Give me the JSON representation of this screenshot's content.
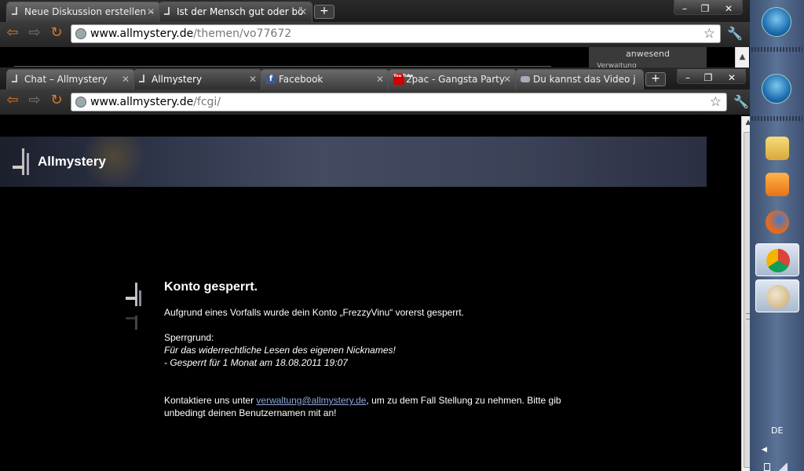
{
  "back_window": {
    "tabs": [
      {
        "label": "Neue Diskussion erstellen –"
      },
      {
        "label": "Ist der Mensch gut oder bö"
      }
    ],
    "url_domain": "www.allmystery.de",
    "url_path": "/themen/vo77672",
    "peek_label": "anwesend",
    "peek_label2": "Verwaltung"
  },
  "front_window": {
    "tabs": [
      {
        "label": "Chat – Allmystery"
      },
      {
        "label": "Allmystery"
      },
      {
        "label": "Facebook"
      },
      {
        "label": "2pac - Gangsta Party"
      },
      {
        "label": "Du kannst das Video j"
      }
    ],
    "url_domain": "www.allmystery.de",
    "url_path": "/fcgi/",
    "youtube_favicon_text": "You Tube",
    "facebook_favicon_text": "f"
  },
  "window_controls": {
    "minimize": "–",
    "maximize": "❐",
    "close": "✕"
  },
  "page": {
    "logo_text": "Allmystery",
    "heading": "Konto gesperrt.",
    "message": "Aufgrund eines Vorfalls wurde dein Konto „FrezzyVinu“ vorerst gesperrt.",
    "reason_label": "Sperrgrund:",
    "reason_line1": "Für das widerrechtliche Lesen des eigenen Nicknames!",
    "reason_line2": "- Gesperrt für 1 Monat am 18.08.2011 19:07",
    "contact_pre": "Kontaktiere uns unter ",
    "contact_email": "verwaltung@allmystery.de",
    "contact_post": ", um zu dem Fall Stellung zu nehmen. Bitte gib unbedingt deinen Benutzernamen mit an!"
  },
  "taskbar": {
    "language": "DE"
  },
  "colors": {
    "link": "#8fa8d8",
    "header_band": "#3a3f55"
  }
}
